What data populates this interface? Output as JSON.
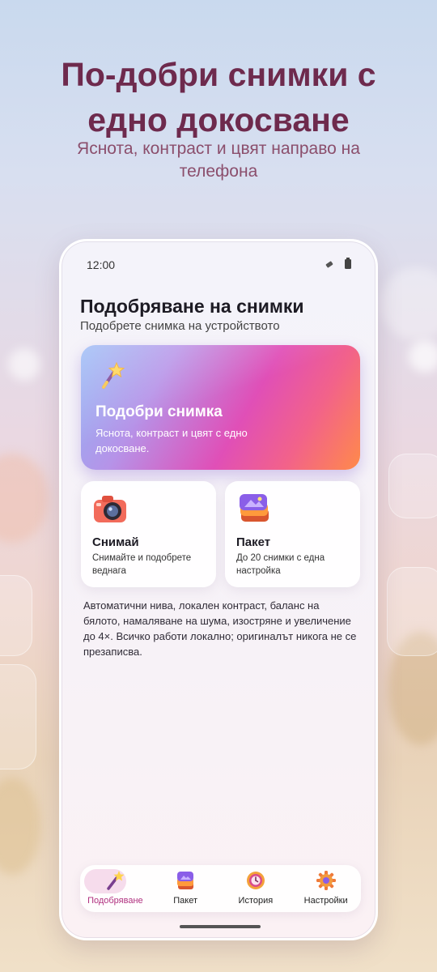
{
  "promo": {
    "headline_line1": "По-добри снимки с",
    "headline_line2": "едно докосване",
    "subline": "Яснота, контраст и цвят направо на телефона"
  },
  "status_bar": {
    "time": "12:00",
    "icons": [
      "satellite-icon",
      "battery-icon"
    ]
  },
  "app": {
    "title": "Подобряване на снимки",
    "subtitle": "Подобрете снимка на устройството"
  },
  "hero_card": {
    "icon": "magic-wand-icon",
    "title": "Подобри снимка",
    "description": "Яснота, контраст и цвят с едно докосване."
  },
  "cards": [
    {
      "icon": "camera-icon",
      "title": "Снимай",
      "description": "Снимайте и подобрете веднага"
    },
    {
      "icon": "stacked-photos-icon",
      "title": "Пакет",
      "description": "До 20 снимки с една настройка"
    }
  ],
  "info_text": "Автоматични нива, локален контраст, баланс на бялото, намаляване на шума, изостряне и увеличение до 4×. Всичко работи локално; оригиналът никога не се презаписва.",
  "nav": {
    "active_index": 0,
    "items": [
      {
        "label": "Подобряване",
        "icon": "magic-wand-icon"
      },
      {
        "label": "Пакет",
        "icon": "stacked-photos-icon"
      },
      {
        "label": "История",
        "icon": "history-icon"
      },
      {
        "label": "Настройки",
        "icon": "gear-icon"
      }
    ]
  },
  "colors": {
    "headline": "#6e2a4d",
    "accent": "#b0307f",
    "hero_gradient": [
      "#8fb5f5",
      "#e04fb7",
      "#ff8a4a"
    ]
  }
}
